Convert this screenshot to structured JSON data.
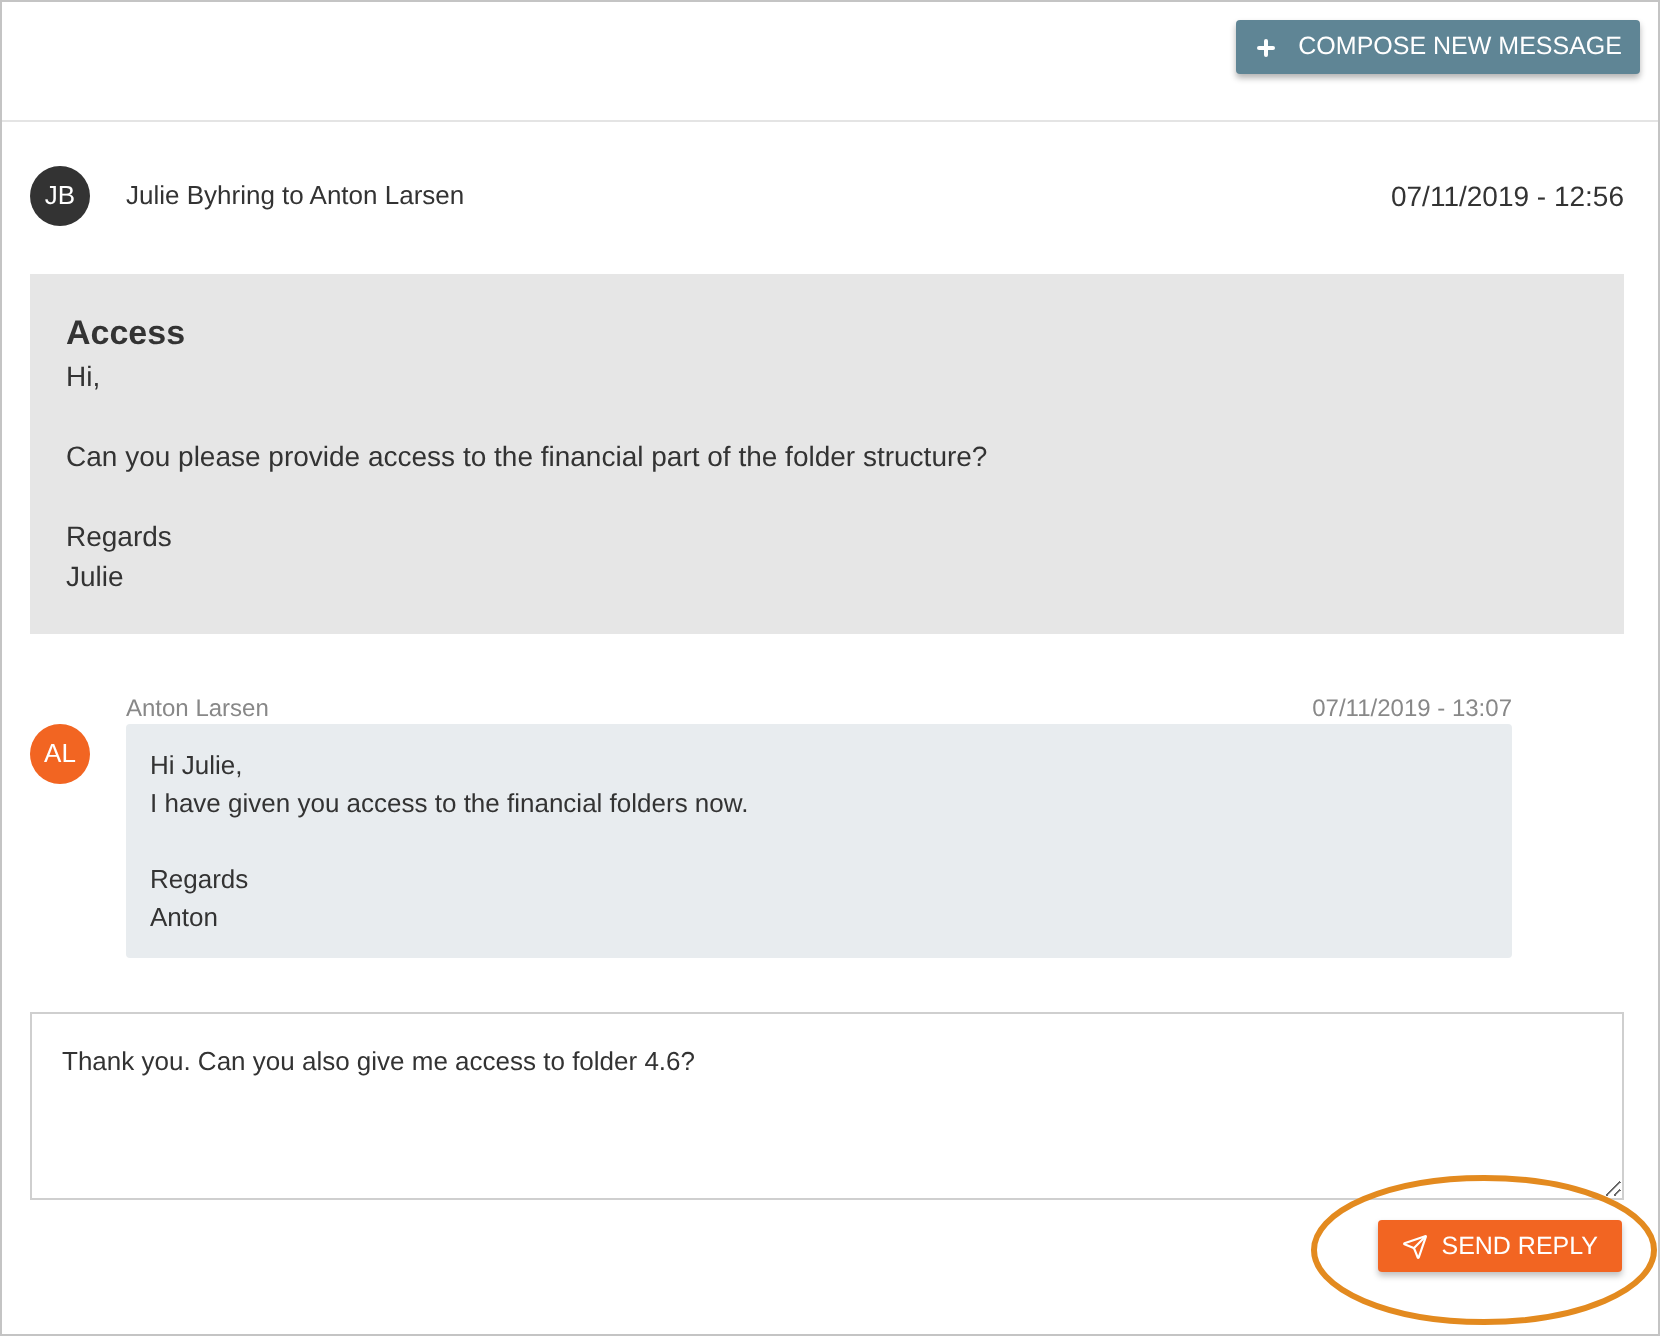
{
  "header": {
    "compose_button": "COMPOSE NEW MESSAGE"
  },
  "thread": [
    {
      "kind": "original",
      "avatar": {
        "initials": "JB",
        "color": "#333333"
      },
      "sender": "Julie Byhring to Anton Larsen",
      "date": "07/11/2019 - 12:56",
      "subject": "Access",
      "body": "Hi,\n\nCan you please provide access to the financial part of the folder structure?\n\nRegards\nJulie"
    },
    {
      "kind": "reply",
      "avatar": {
        "initials": "AL",
        "color": "#f26522"
      },
      "sender": "Anton Larsen",
      "date": "07/11/2019 - 13:07",
      "body": "Hi Julie,\nI have given you access to the financial folders now.\n\nRegards\nAnton"
    }
  ],
  "reply_box": {
    "value": "Thank you. Can you also give me access to folder 4.6?"
  },
  "send_button": "SEND REPLY"
}
